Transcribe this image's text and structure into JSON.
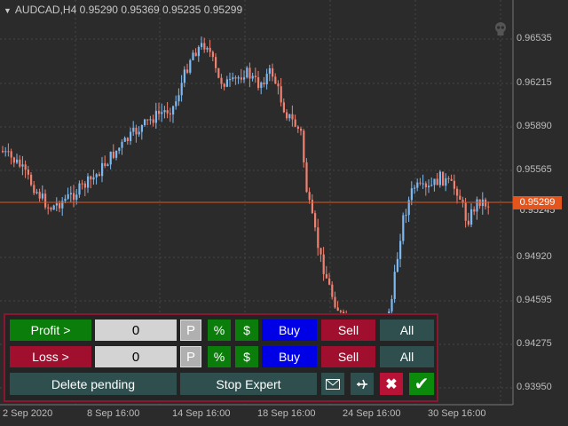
{
  "chart": {
    "symbol_header": "AUDCAD,H4  0.95290 0.95369 0.95235 0.95299",
    "current_price": "0.95299",
    "current_price_underlay": "0.95245",
    "price_axis": [
      "0.96535",
      "0.96215",
      "0.95890",
      "0.95565",
      "0.94920",
      "0.94595",
      "0.94275",
      "0.93950"
    ],
    "time_axis": [
      "2 Sep 2020",
      "8 Sep 16:00",
      "14 Sep 16:00",
      "18 Sep 16:00",
      "24 Sep 16:00",
      "30 Sep 16:00"
    ],
    "colors": {
      "background": "#2b2b2b",
      "bull": "#7db9f0",
      "bear": "#f08070",
      "current_line": "#e4551d",
      "grid": "#4a4a4a",
      "panel_border": "#8b1630"
    },
    "icons": {
      "skull": "skull-icon"
    }
  },
  "panel": {
    "profit_label": "Profit >",
    "profit_value": "0",
    "loss_label": "Loss >",
    "loss_value": "0",
    "p_label": "P",
    "percent_label": "%",
    "dollar_label": "$",
    "buy_label": "Buy",
    "sell_label": "Sell",
    "all_label": "All",
    "delete_pending_label": "Delete pending",
    "stop_expert_label": "Stop Expert",
    "icons": {
      "mail": "mail-icon",
      "send": "plane-icon",
      "close": "close-icon",
      "confirm": "checkmark-icon"
    }
  }
}
